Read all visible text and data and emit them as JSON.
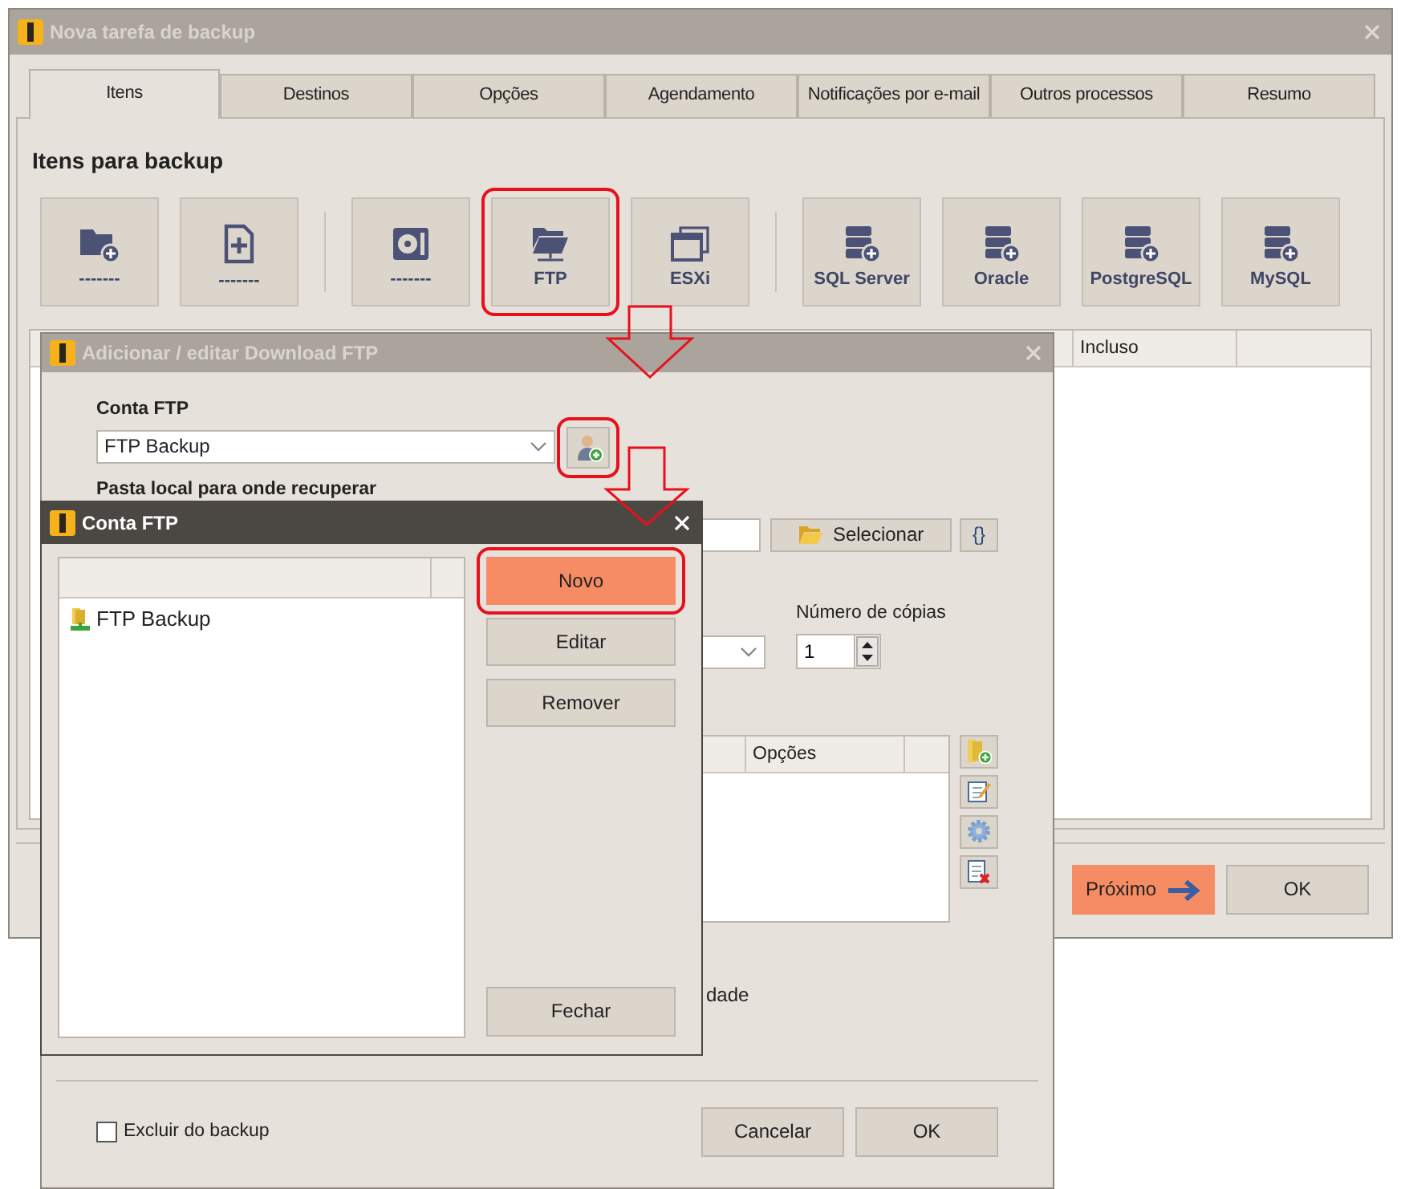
{
  "main_window": {
    "title": "Nova tarefa de backup",
    "active": false,
    "tabs": [
      {
        "label": "Itens",
        "selected": true
      },
      {
        "label": "Destinos",
        "selected": false
      },
      {
        "label": "Opções",
        "selected": false
      },
      {
        "label": "Agendamento",
        "selected": false
      },
      {
        "label": "Notificações por e-mail",
        "selected": false
      },
      {
        "label": "Outros processos",
        "selected": false
      },
      {
        "label": "Resumo",
        "selected": false
      }
    ],
    "section_title": "Itens para backup",
    "item_groups": [
      [
        {
          "label": "-------",
          "kind": "folder",
          "highlighted": false
        },
        {
          "label": "-------",
          "kind": "file",
          "highlighted": false
        }
      ],
      [
        {
          "label": "-------",
          "kind": "disk",
          "highlighted": false
        },
        {
          "label": "FTP",
          "kind": "ftp",
          "highlighted": true
        },
        {
          "label": "ESXi",
          "kind": "esxi",
          "highlighted": false
        }
      ],
      [
        {
          "label": "SQL Server",
          "kind": "database",
          "highlighted": false
        },
        {
          "label": "Oracle",
          "kind": "database",
          "highlighted": false
        },
        {
          "label": "PostgreSQL",
          "kind": "database",
          "highlighted": false
        },
        {
          "label": "MySQL",
          "kind": "database",
          "highlighted": false
        }
      ]
    ],
    "list": {
      "columns": [
        "Incluso"
      ]
    },
    "buttons": [
      {
        "label": "Próximo",
        "kind": "next"
      },
      {
        "label": "OK",
        "kind": "default"
      }
    ]
  },
  "ftp_dialog": {
    "title": "Adicionar / editar Download FTP",
    "active": false,
    "account_label": "Conta FTP",
    "account_value": "FTP Backup",
    "account_button_highlighted": true,
    "folder_label": "Pasta local para onde recuperar",
    "select_button": "Selecionar",
    "vars_button": "{}",
    "copies_label": "Número de cópias",
    "copies_value": "1",
    "table": {
      "columns": [
        "Opções"
      ]
    },
    "option_fragment": "dade",
    "exclude": {
      "label": "Excluir do backup",
      "checked": false
    },
    "buttons": [
      "Cancelar",
      "OK"
    ]
  },
  "account_dialog": {
    "title": "Conta FTP",
    "active": true,
    "accounts": [
      {
        "name": "FTP Backup",
        "selected": false
      }
    ],
    "buttons": [
      {
        "label": "Novo",
        "kind": "primary",
        "highlighted": true
      },
      {
        "label": "Editar",
        "kind": "default",
        "highlighted": false
      },
      {
        "label": "Remover",
        "kind": "default",
        "highlighted": false
      }
    ],
    "close_button": "Fechar"
  }
}
